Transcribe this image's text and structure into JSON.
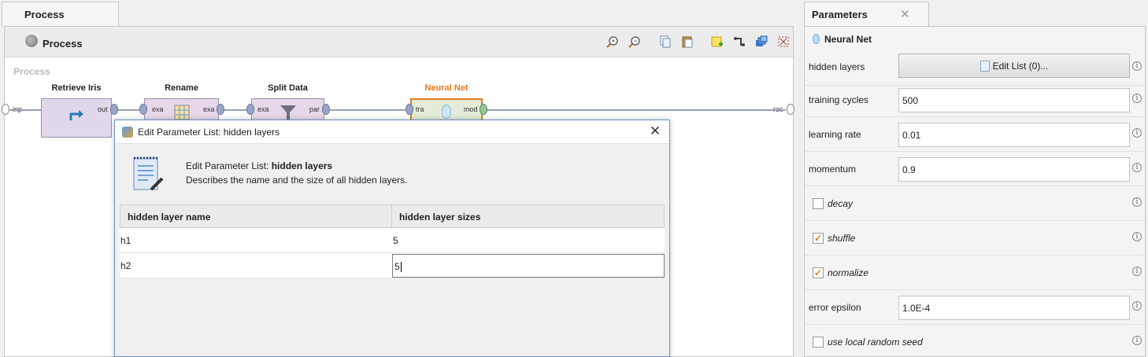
{
  "process_tab": {
    "label": "Process"
  },
  "process_panel": {
    "title": "Process",
    "canvas_label": "Process",
    "toolbar_icons": [
      "zoom-in-icon",
      "zoom-out-icon",
      "copy-icon",
      "paste-icon",
      "add-note-icon",
      "auto-wire-icon",
      "layers-icon",
      "fit-icon"
    ],
    "left_port": "inp",
    "right_port": "res"
  },
  "operators": [
    {
      "name": "Retrieve Iris",
      "ports_in": [],
      "ports_out": [
        "out"
      ]
    },
    {
      "name": "Rename",
      "ports_in": [
        "exa"
      ],
      "ports_out": [
        "exa"
      ]
    },
    {
      "name": "Split Data",
      "ports_in": [
        "exa"
      ],
      "ports_out": [
        "par"
      ]
    },
    {
      "name": "Neural Net",
      "ports_in": [
        "tra"
      ],
      "ports_out": [
        "mod"
      ],
      "highlight": "#e07a20"
    }
  ],
  "dialog": {
    "title": "Edit Parameter List: hidden layers",
    "heading_prefix": "Edit Parameter List: ",
    "heading_bold": "hidden layers",
    "description": "Describes the name and the size of all hidden layers.",
    "columns": [
      "hidden layer name",
      "hidden layer sizes"
    ],
    "rows": [
      {
        "name": "h1",
        "size": "5"
      },
      {
        "name": "h2",
        "size": "5"
      }
    ]
  },
  "parameters": {
    "tab_label": "Parameters",
    "operator": "Neural Net",
    "hidden_layers": {
      "label": "hidden layers",
      "button": "Edit List (0)..."
    },
    "training_cycles": {
      "label": "training cycles",
      "value": "500"
    },
    "learning_rate": {
      "label": "learning rate",
      "value": "0.01"
    },
    "momentum": {
      "label": "momentum",
      "value": "0.9"
    },
    "decay": {
      "label": "decay",
      "checked": false
    },
    "shuffle": {
      "label": "shuffle",
      "checked": true
    },
    "normalize": {
      "label": "normalize",
      "checked": true
    },
    "error_epsilon": {
      "label": "error epsilon",
      "value": "1.0E-4"
    },
    "use_local_random_seed": {
      "label": "use local random seed",
      "checked": false
    },
    "checkmark": "✓",
    "info_glyph": "i"
  }
}
